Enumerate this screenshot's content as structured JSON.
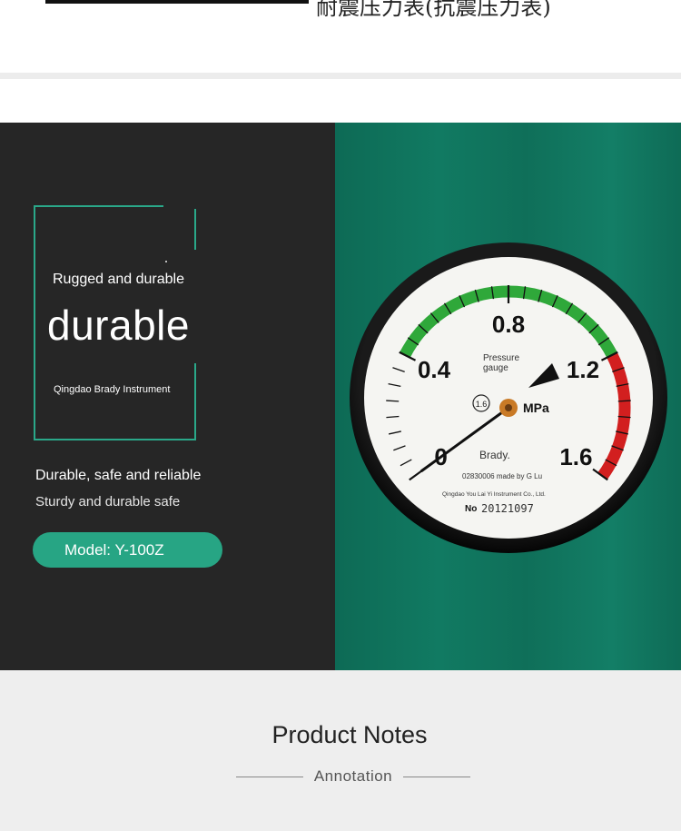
{
  "banner": {
    "chinese_title": "耐震压力表(抗震压力表)"
  },
  "hero": {
    "tagline": "Rugged and durable",
    "headline": "durable",
    "maker": "Qingdao Brady Instrument",
    "feature_primary": "Durable, safe and reliable",
    "feature_secondary": "Sturdy and durable safe",
    "model_label": "Model: Y-100Z",
    "left_bg": "#262626",
    "accent": "#27a584"
  },
  "gauge": {
    "scale_labels": [
      "0",
      "0.4",
      "0.8",
      "1.2",
      "1.6"
    ],
    "unit": "MPa",
    "type_line_1": "Pressure",
    "type_line_2": "gauge",
    "accuracy_class": "1.6",
    "brand": "Brady.",
    "cert_line": "02830006 made by G Lu",
    "company_line": "Qingdao You Lai Yi Instrument Co., Ltd.",
    "serial_prefix": "No",
    "serial_number": "20121097",
    "needle_reading_mpa": 0.0,
    "green_band_mpa": [
      0.4,
      1.2
    ],
    "red_band_mpa": [
      1.2,
      1.6
    ],
    "range_mpa": [
      0,
      1.6
    ]
  },
  "notes": {
    "title": "Product Notes",
    "subtitle": "Annotation"
  }
}
